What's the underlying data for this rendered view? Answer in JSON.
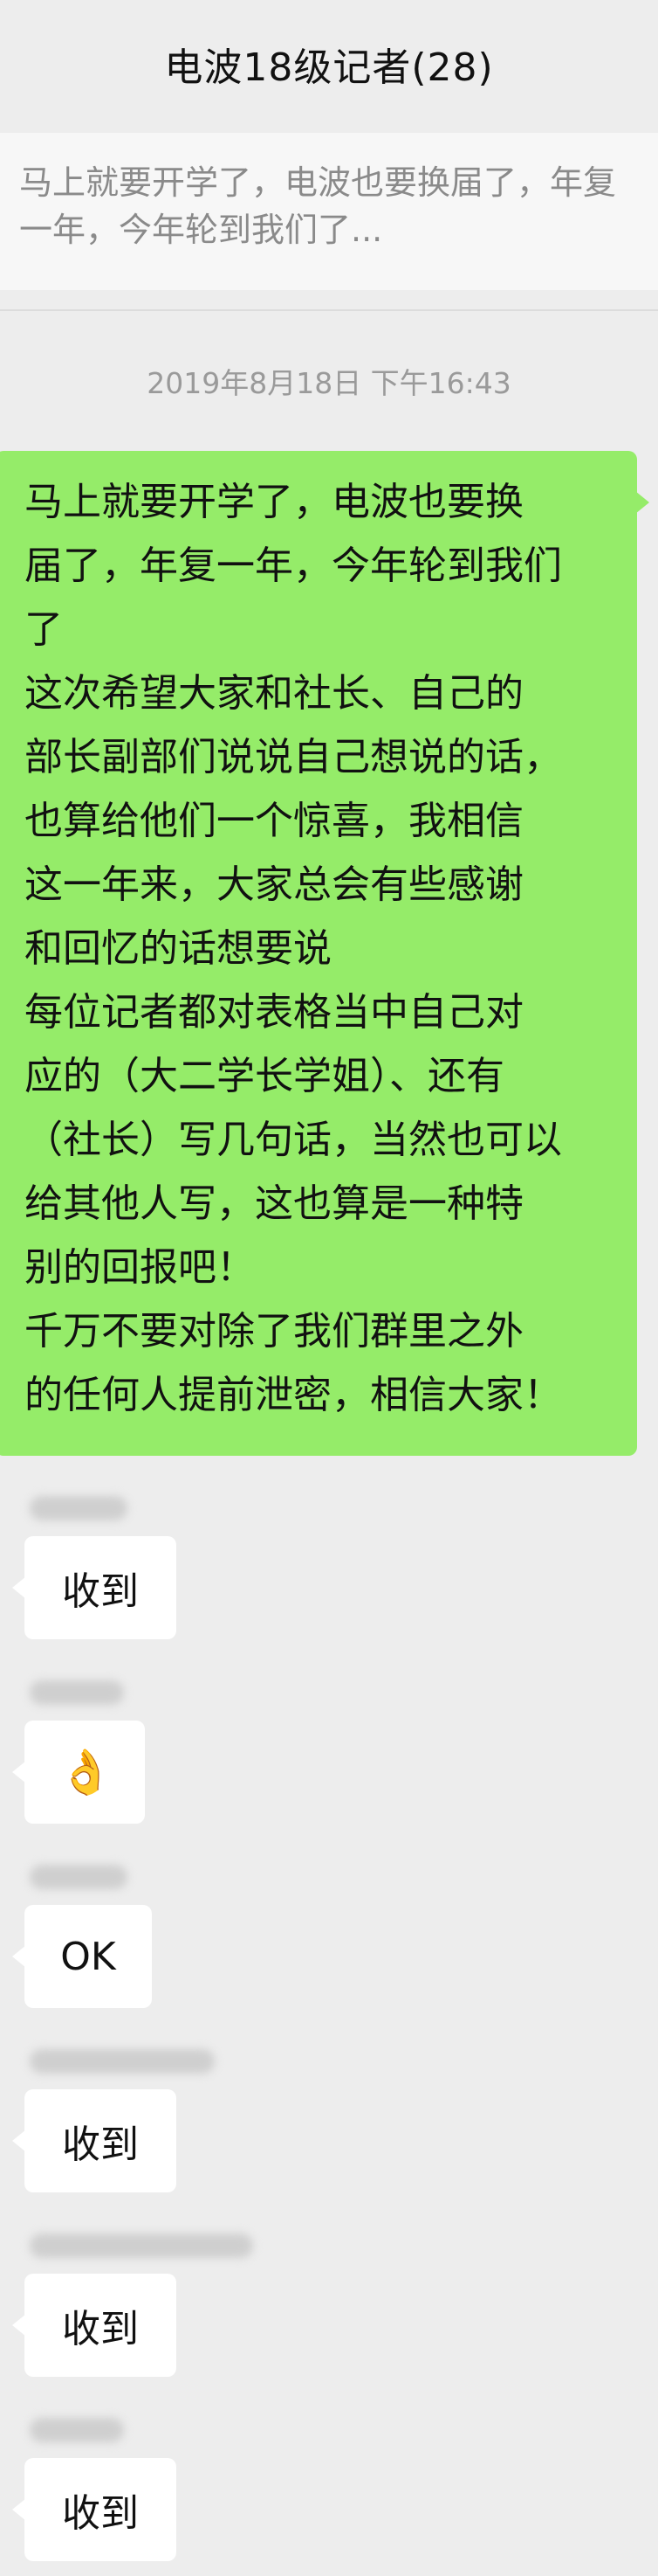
{
  "header": {
    "title": "电波18级记者(28)"
  },
  "notice": {
    "lines": [
      "马上就要开学了，电波也要换届了，年复",
      "一年，今年轮到我们了..."
    ]
  },
  "timestamp": "2019年8月18日 下午16:43",
  "outgoing_message": {
    "lines": [
      "马上就要开学了，电波也要换",
      "届了，年复一年，今年轮到我们",
      "了",
      "这次希望大家和社长、自己的",
      "部长副部们说说自己想说的话，",
      "也算给他们一个惊喜，我相信",
      "这一年来，大家总会有些感谢",
      "和回忆的话想要说",
      "每位记者都对表格当中自己对",
      "应的（大二学长学姐）、还有",
      "（社长）写几句话，当然也可以",
      "给其他人写，这也算是一种特",
      "别的回报吧！",
      "千万不要对除了我们群里之外",
      "的任何人提前泄密，相信大家！"
    ]
  },
  "incoming_messages": [
    {
      "text": "收到"
    },
    {
      "text": "",
      "icon": "ok-hand-emoji",
      "emoji": "👌"
    },
    {
      "text": "OK"
    },
    {
      "text": "收到"
    },
    {
      "text": "收到"
    },
    {
      "text": "收到"
    }
  ],
  "colors": {
    "background": "#ededed",
    "outgoing_bubble": "#95ec69",
    "incoming_bubble": "#ffffff"
  }
}
